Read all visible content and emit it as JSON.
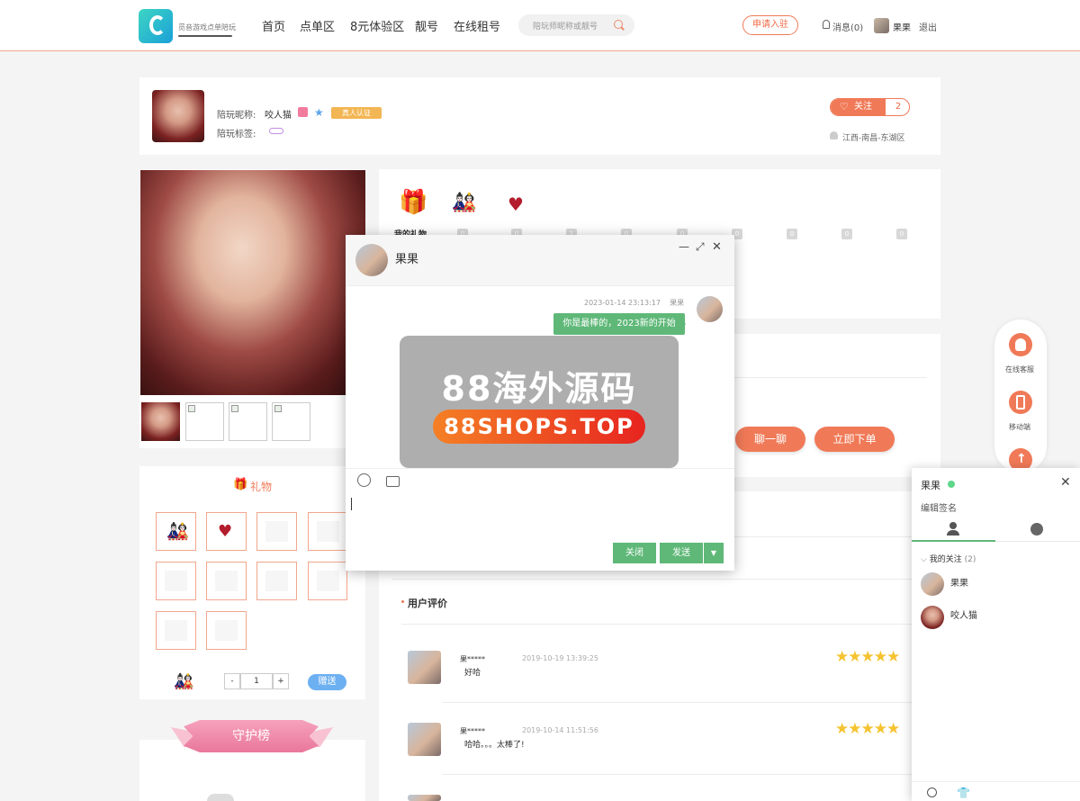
{
  "header": {
    "logo_text": "觅音游戏点单陪玩",
    "nav": [
      "首页",
      "点单区",
      "8元体验区",
      "靓号",
      "在线租号"
    ],
    "search_placeholder": "陪玩师昵称或靓号",
    "apply_label": "申请入驻",
    "messages_label": "消息(0)",
    "username": "果果",
    "logout_label": "退出"
  },
  "profile": {
    "nickname_label": "陪玩昵称:",
    "nickname": "咬人猫",
    "auth_badge": "真人认证",
    "tags_label": "陪玩标签:",
    "follow_label": "关注",
    "follow_count": "2",
    "location": "江西-南昌-东湖区"
  },
  "gifts": {
    "title": "礼物",
    "quantity": "1",
    "minus": "-",
    "plus": "+",
    "give_label": "赠送",
    "counts": [
      "0",
      "0",
      "1",
      "0",
      "0",
      "0",
      "0",
      "0",
      "0"
    ],
    "my_gifts_label": "我的礼物"
  },
  "guard": {
    "title": "守护榜"
  },
  "actions": {
    "chat_label": "聊一聊",
    "order_label": "立即下单"
  },
  "reviews": {
    "title": "用户评价",
    "items": [
      {
        "name": "果*****",
        "time": "2019-10-19 13:39:25",
        "text": "好哈",
        "stars": "★★★★★"
      },
      {
        "name": "果*****",
        "time": "2019-10-14 11:51:56",
        "text": "哈哈。。。太棒了!",
        "stars": "★★★★★"
      }
    ]
  },
  "floating_sidebar": {
    "service_label": "在线客服",
    "mobile_label": "移动端"
  },
  "chat_window": {
    "contact_name": "果果",
    "message": {
      "time": "2023-01-14 23:13:17",
      "sender": "果果",
      "text": "你是最棒的，2023新的开始"
    },
    "close_label": "关闭",
    "send_label": "发送"
  },
  "watermark": {
    "line1": "88海外源码",
    "line2": "88SHOPS.TOP"
  },
  "im_panel": {
    "name": "果果",
    "signature": "编辑签名",
    "group_label": "我的关注",
    "group_count": "(2)",
    "friends": [
      "果果",
      "咬人猫"
    ]
  },
  "colors": {
    "accent": "#f07a58",
    "green": "#5fb878",
    "star": "#f4c32f"
  }
}
